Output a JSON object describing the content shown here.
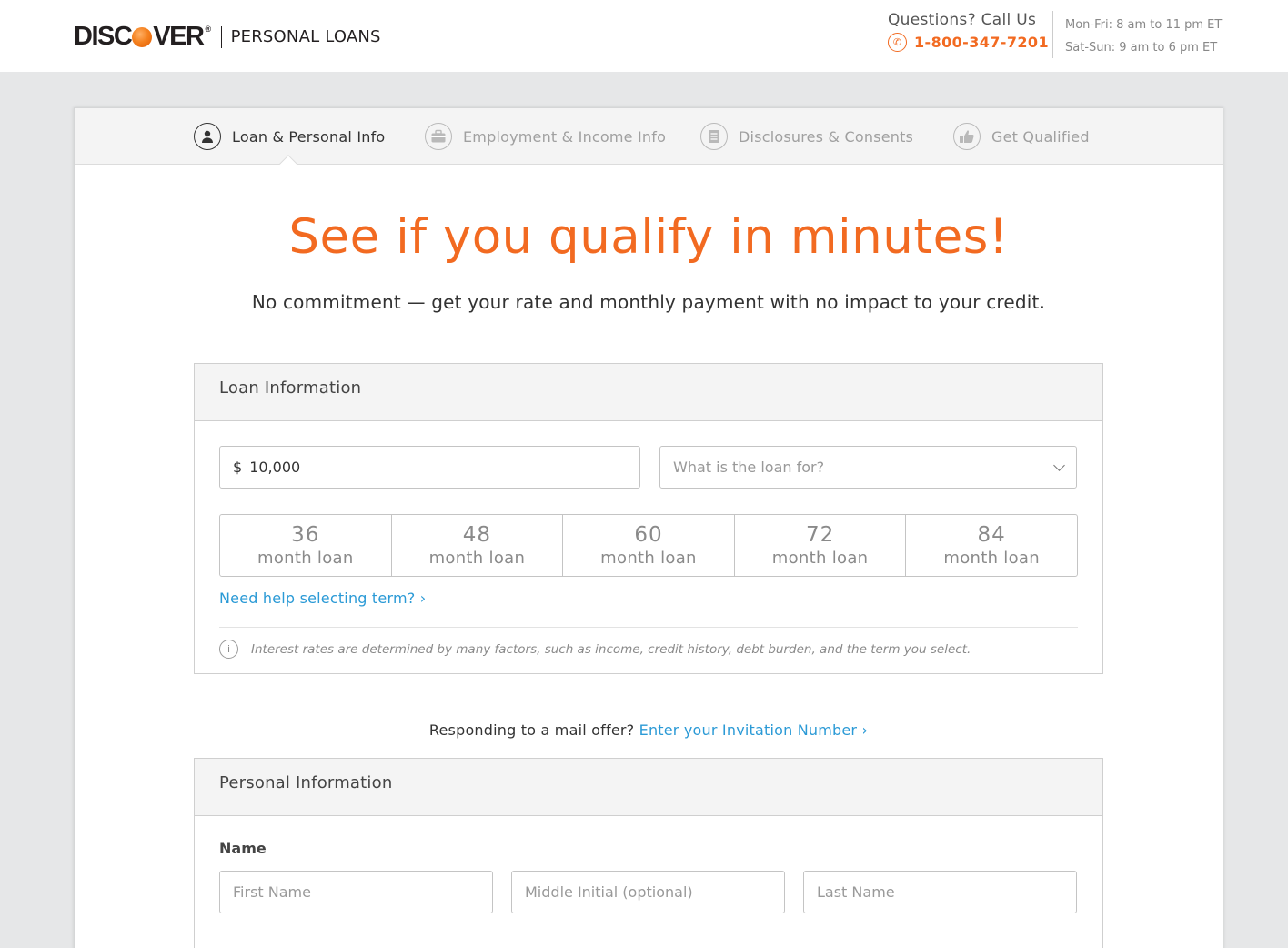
{
  "header": {
    "logo_text_left": "DISC",
    "logo_text_right": "VER",
    "logo_tm": "®",
    "logo_sub": "PERSONAL LOANS",
    "questions": "Questions?  Call Us",
    "phone": "1-800-347-7201",
    "hours_weekday": "Mon-Fri: 8 am to 11 pm ET",
    "hours_weekend": "Sat-Sun: 9 am to  6 pm  ET"
  },
  "steps": [
    {
      "label": "Loan & Personal Info",
      "icon": "person-icon",
      "active": true
    },
    {
      "label": "Employment & Income Info",
      "icon": "briefcase-icon",
      "active": false
    },
    {
      "label": "Disclosures & Consents",
      "icon": "document-icon",
      "active": false
    },
    {
      "label": "Get Qualified",
      "icon": "thumbs-up-icon",
      "active": false
    }
  ],
  "hero": {
    "headline": "See if you qualify in minutes!",
    "subhead": "No commitment — get your rate and monthly payment with no impact to your credit."
  },
  "loan_info": {
    "title": "Loan Information",
    "currency": "$",
    "amount": "10,000",
    "purpose_placeholder": "What is the loan for?",
    "terms": [
      {
        "num": "36",
        "label": "month loan"
      },
      {
        "num": "48",
        "label": "month loan"
      },
      {
        "num": "60",
        "label": "month loan"
      },
      {
        "num": "72",
        "label": "month loan"
      },
      {
        "num": "84",
        "label": "month loan"
      }
    ],
    "help_link": "Need help selecting term? ›",
    "note": "Interest rates are determined by many factors, such as income, credit history, debt burden, and the term you select."
  },
  "mail_offer": {
    "text": "Responding to a mail offer?",
    "link": "Enter your Invitation Number ›"
  },
  "personal_info": {
    "title": "Personal Information",
    "name_label": "Name",
    "first_placeholder": "First Name",
    "middle_placeholder": "Middle Initial (optional)",
    "last_placeholder": "Last Name"
  },
  "colors": {
    "accent": "#f26a21",
    "link": "#2b9ad6",
    "background": "#e6e7e8"
  }
}
